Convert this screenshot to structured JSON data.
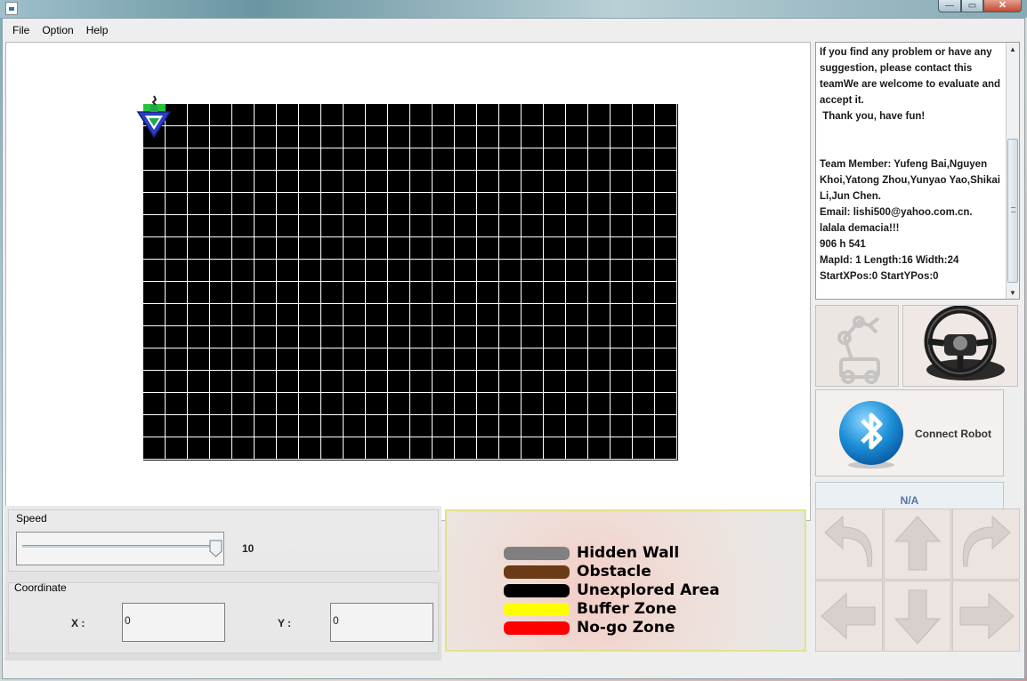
{
  "window": {
    "title": "",
    "controls": {
      "minimize": "—",
      "maximize": "▭",
      "close": "✕"
    }
  },
  "menu": [
    "File",
    "Option",
    "Help"
  ],
  "info": {
    "text": "If you find any problem or have any suggestion, please contact this teamWe are welcome to evaluate and accept it.\n Thank you, have fun!\n\n\nTeam Member: Yufeng Bai,Nguyen Khoi,Yatong Zhou,Yunyao Yao,Shikai Li,Jun Chen.\nEmail: lishi500@yahoo.com.cn.\nlalala demacia!!!\n906 h 541\nMapId: 1 Length:16 Width:24\nStartXPos:0 StartYPos:0"
  },
  "map": {
    "columns": 24,
    "rows": 16,
    "cell_color": "#000000",
    "line_color": "#ffffff",
    "start_color": "#27c23a"
  },
  "connect": {
    "label": "Connect Robot"
  },
  "status": {
    "text": "N/A"
  },
  "speed": {
    "title": "Speed",
    "value": "10",
    "level": 1.0
  },
  "coordinate": {
    "title": "Coordinate",
    "x_label": "X :",
    "y_label": "Y :",
    "x_value": "0",
    "y_value": "0"
  },
  "legend": [
    {
      "color": "#808080",
      "label": "Hidden Wall"
    },
    {
      "color": "#6b3a17",
      "label": "Obstacle"
    },
    {
      "color": "#000000",
      "label": "Unexplored Area"
    },
    {
      "color": "#ffff00",
      "label": "Buffer Zone"
    },
    {
      "color": "#ff0000",
      "label": "No-go Zone"
    }
  ],
  "controls": {
    "arrows": [
      "turn-left",
      "forward",
      "turn-right",
      "left",
      "backward",
      "right"
    ]
  }
}
